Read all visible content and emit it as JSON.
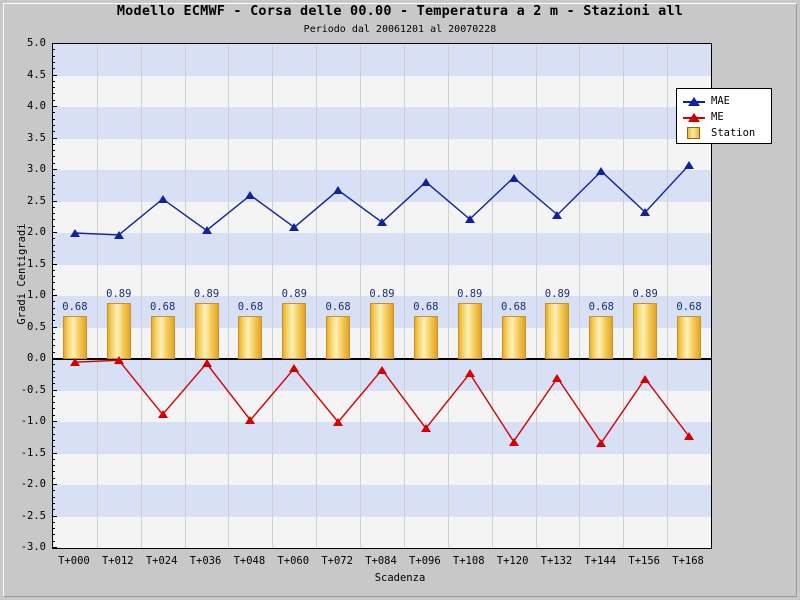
{
  "window": {
    "background_color": "#c8c8c8"
  },
  "chart_data": {
    "type": "line",
    "title": "Modello ECMWF - Corsa delle 00.00 - Temperatura a 2 m -  Stazioni all",
    "subtitle": "Periodo dal 20061201 al 20070228",
    "xlabel": "Scadenza",
    "ylabel": "Gradi Centigradi",
    "ylim": [
      -3.0,
      5.0
    ],
    "ytick_step": 0.5,
    "yticks": [
      "5.0",
      "4.5",
      "4.0",
      "3.5",
      "3.0",
      "2.5",
      "2.0",
      "1.5",
      "1.0",
      "0.5",
      "0.0",
      "-0.5",
      "-1.0",
      "-1.5",
      "-2.0",
      "-2.5",
      "-3.0"
    ],
    "grid": "horizontal-bands",
    "legend_position": "top-right",
    "categories": [
      "T+000",
      "T+012",
      "T+024",
      "T+036",
      "T+048",
      "T+060",
      "T+072",
      "T+084",
      "T+096",
      "T+108",
      "T+120",
      "T+132",
      "T+144",
      "T+156",
      "T+168"
    ],
    "series": [
      {
        "name": "MAE",
        "color": "#10239e",
        "marker": "triangle-up",
        "values": [
          2.0,
          1.97,
          2.54,
          2.04,
          2.6,
          2.09,
          2.68,
          2.17,
          2.81,
          2.22,
          2.88,
          2.29,
          2.98,
          2.33,
          3.08
        ]
      },
      {
        "name": "ME",
        "color": "#d40000",
        "marker": "triangle-up",
        "values": [
          -0.05,
          -0.02,
          -0.88,
          -0.07,
          -0.97,
          -0.15,
          -1.0,
          -0.17,
          -1.1,
          -0.23,
          -1.31,
          -0.3,
          -1.33,
          -0.31,
          -1.23
        ]
      },
      {
        "name": "Station",
        "color": "#edb93c",
        "marker": "bar",
        "values": [
          0.68,
          0.89,
          0.68,
          0.89,
          0.68,
          0.89,
          0.68,
          0.89,
          0.68,
          0.89,
          0.68,
          0.89,
          0.68,
          0.89,
          0.68
        ],
        "value_labels": [
          "0.68",
          "0.89",
          "0.68",
          "0.89",
          "0.68",
          "0.89",
          "0.68",
          "0.89",
          "0.68",
          "0.89",
          "0.68",
          "0.89",
          "0.68",
          "0.89",
          "0.68"
        ]
      }
    ]
  },
  "legend": {
    "items": [
      {
        "label": "MAE",
        "symbol": "triangle-up-icon",
        "color": "#10239e"
      },
      {
        "label": "ME",
        "symbol": "triangle-up-icon",
        "color": "#d40000"
      },
      {
        "label": "Station",
        "symbol": "square-icon",
        "color": "#edb93c"
      }
    ]
  }
}
